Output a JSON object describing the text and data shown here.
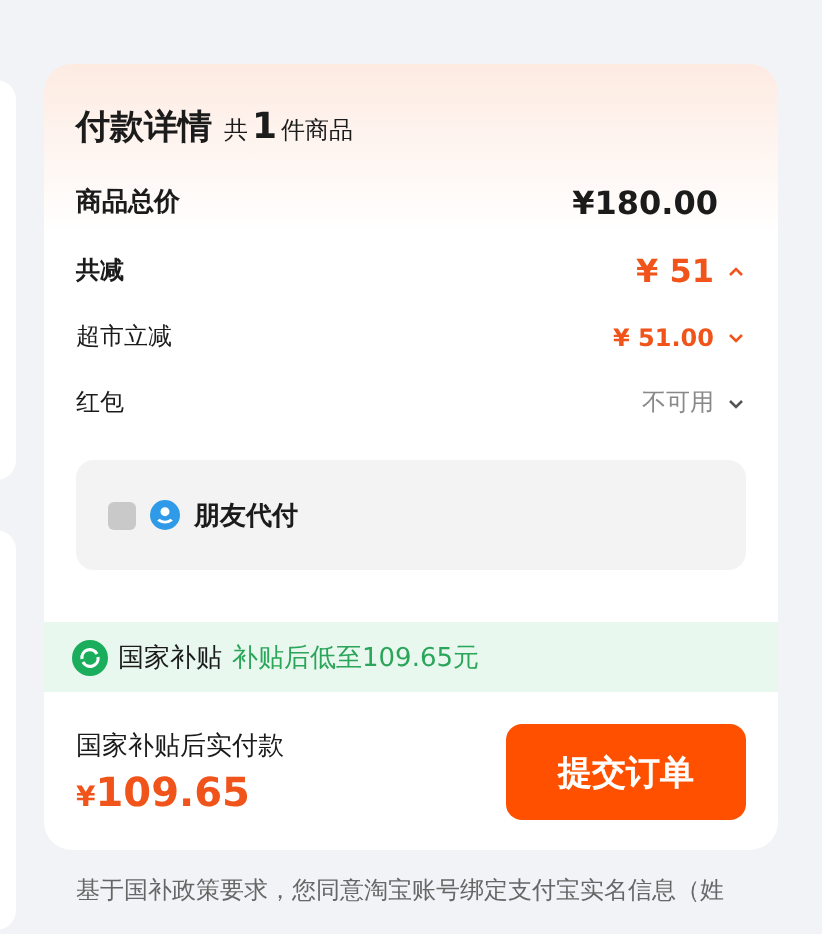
{
  "header": {
    "title": "付款详情",
    "count_prefix": "共",
    "count": "1",
    "count_suffix": "件商品"
  },
  "rows": [
    {
      "kind": "total",
      "label": "商品总价",
      "value": "¥180.00"
    },
    {
      "kind": "discount",
      "label": "共减",
      "value": "¥ 51",
      "expanded": true
    },
    {
      "kind": "sub",
      "label": "超市立减",
      "value": "¥ 51.00",
      "expanded": false
    },
    {
      "kind": "muted",
      "label": "红包",
      "value": "不可用",
      "expanded": false
    }
  ],
  "friend_pay": {
    "label": "朋友代付",
    "checked": false
  },
  "subsidy": {
    "label": "国家补贴",
    "note": "补贴后低至109.65元"
  },
  "footer": {
    "label": "国家补贴后实付款",
    "currency": "¥",
    "amount": "109.65",
    "button": "提交订单"
  },
  "notice": "基于国补政策要求，您同意淘宝账号绑定支付宝实名信息（姓"
}
